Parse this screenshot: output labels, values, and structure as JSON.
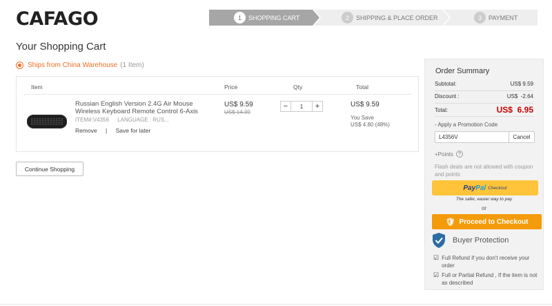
{
  "brand": {
    "logo": "CAFAGO"
  },
  "steps": [
    {
      "num": "1",
      "label": "SHOPPING CART"
    },
    {
      "num": "2",
      "label": "SHIPPING & PLACE ORDER"
    },
    {
      "num": "3",
      "label": "PAYMENT"
    }
  ],
  "page_title": "Your Shopping Cart",
  "shipping": {
    "warehouse": "Ships from China Warehouse",
    "count": "(1 Item)"
  },
  "table": {
    "headers": {
      "item": "Item",
      "price": "Price",
      "qty": "Qty",
      "total": "Total"
    },
    "row": {
      "name": "Russian English Version 2.4G Air Mouse Wireless Keyboard Remote Control 6-Axis",
      "item_no": "ITEM#:V4356",
      "language": "LANGUAGE : RUS...",
      "remove": "Remove",
      "separator": "|",
      "save_later": "Save for later",
      "price": "US$ 9.59",
      "old_price": "US$ 14.39",
      "qty_minus": "−",
      "qty": "1",
      "qty_plus": "+",
      "total": "US$ 9.59",
      "you_save": "You Save",
      "save_amount": "US$ 4.80 (48%)"
    }
  },
  "continue_label": "Continue Shopping",
  "summary": {
    "title": "Order Summary",
    "subtotal_label": "Subtotal:",
    "subtotal": "US$ 9.59",
    "discount_label": "Discount :",
    "discount": "US$  -2.64",
    "total_label": "Total:",
    "total": "US$  6.95",
    "promo_label": "- Apply a Promotion Code",
    "promo_value": "L4356V",
    "cancel": "Cancel",
    "points": "+Points",
    "points_help": "?",
    "flash_note": "Flash deals are not allowed with coupon and points",
    "paypal_pay": "Pay",
    "paypal_pal": "Pal",
    "paypal_checkout": "Checkout",
    "paypal_tagline": "The safer, easier way to pay",
    "or": "or",
    "checkout": "Proceed to Checkout",
    "protection_title": "Buyer Protection",
    "guarantees": [
      "Full Refund if you don't receive your order",
      "Full or Partial Refund , If the item is not as described"
    ]
  },
  "colors": {
    "accent": "#f36c21",
    "checkout": "#f49b0b",
    "paypal": "#ffc439",
    "total": "#cc0000",
    "shield": "#2e6da4"
  }
}
